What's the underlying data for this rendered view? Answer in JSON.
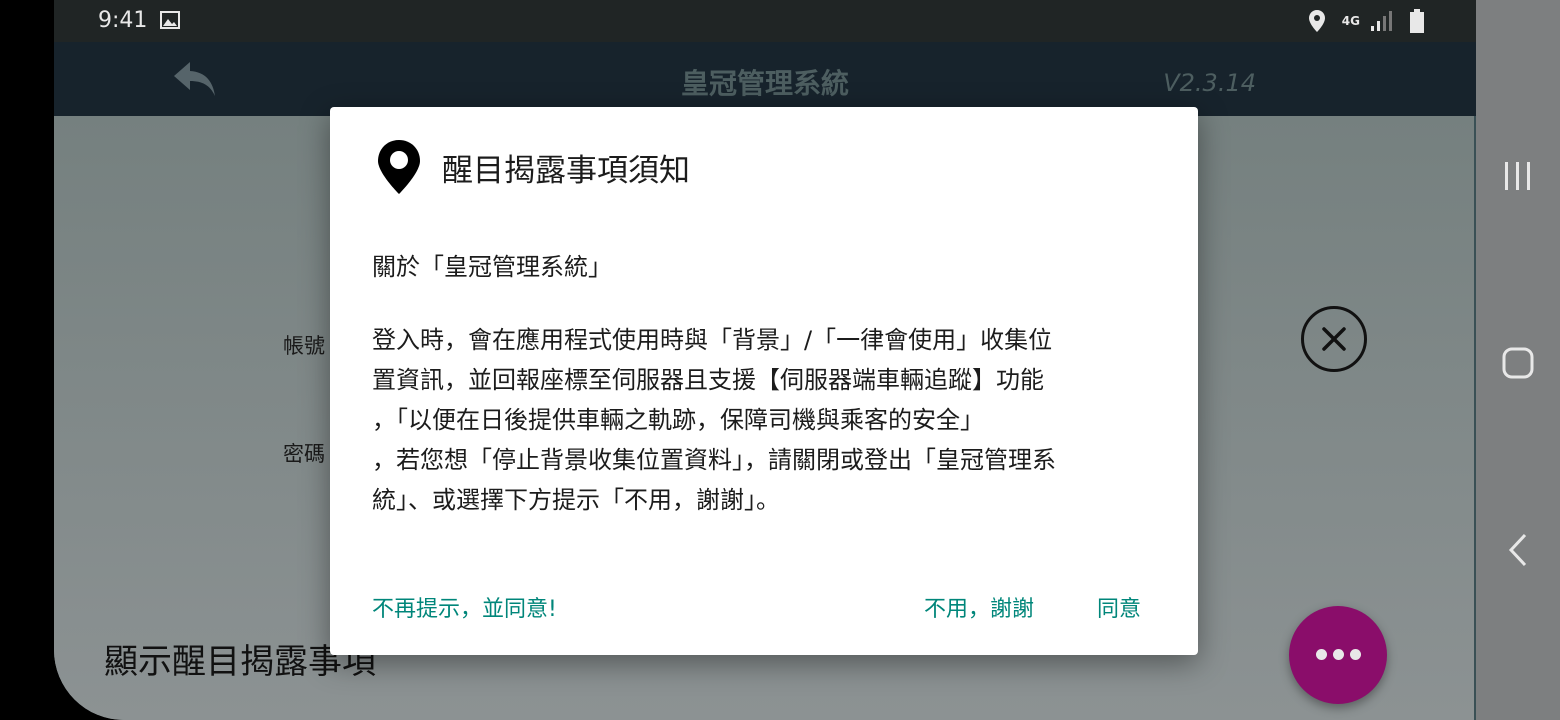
{
  "status_bar": {
    "time": "9:41",
    "network": "4G"
  },
  "app_bar": {
    "title": "皇冠管理系統",
    "version": "V2.3.14"
  },
  "login": {
    "account_label": "帳號",
    "password_label": "密碼",
    "footer_text": "顯示醒目揭露事項"
  },
  "dialog": {
    "title": "醒目揭露事項須知",
    "body_heading": "關於「皇冠管理系統」",
    "body_lines": [
      "登入時，會在應用程式使用時與「背景」/「一律會使用」收集位",
      "置資訊，並回報座標至伺服器且支援【伺服器端車輛追蹤】功能",
      "，「以便在日後提供車輛之軌跡，保障司機與乘客的安全」",
      "，若您想「停止背景收集位置資料」，請關閉或登出「皇冠管理系",
      "統」、或選擇下方提示「不用，謝謝」。"
    ],
    "buttons": {
      "dont_show": "不再提示，並同意!",
      "no_thanks": "不用，謝謝",
      "agree": "同意"
    }
  },
  "icons": {
    "status_gallery": "image-icon",
    "status_location": "location-icon",
    "status_signal": "signal-icon",
    "status_battery": "battery-icon",
    "back": "back-arrow-icon",
    "dialog_pin": "map-pin-icon",
    "close": "close-icon",
    "fab": "more-dots-icon",
    "nav_recents": "recents-icon",
    "nav_home": "home-icon",
    "nav_back": "back-chevron-icon"
  },
  "colors": {
    "accent": "#00867a",
    "fab": "#8a0d6a",
    "app_bar": "#17232c"
  }
}
